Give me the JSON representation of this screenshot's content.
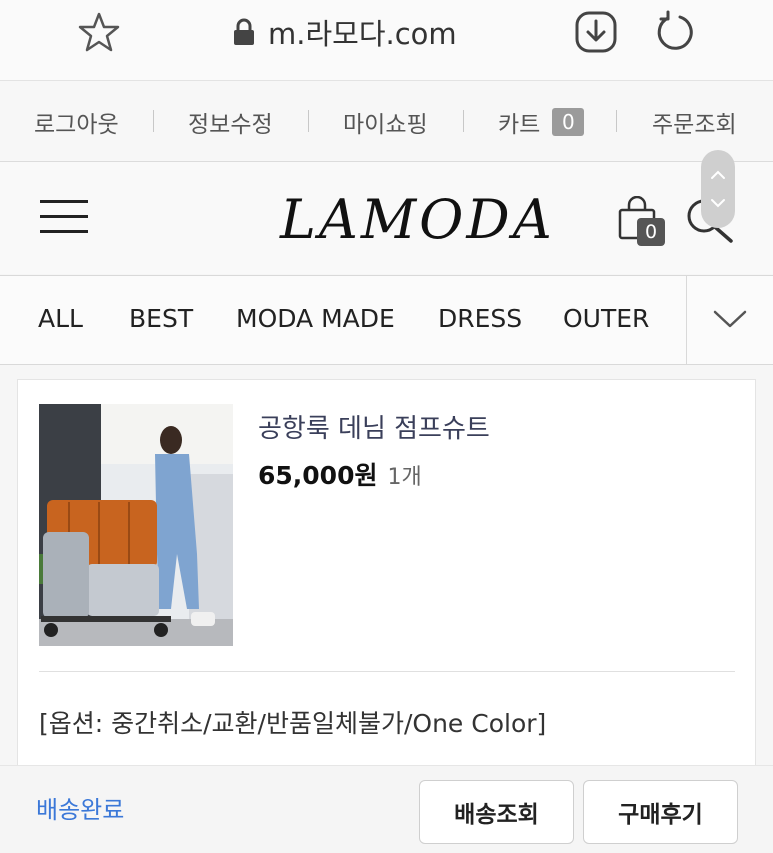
{
  "browser": {
    "url": "m.라모다.com",
    "icons": [
      "star-icon",
      "lock-icon",
      "download-icon",
      "reload-icon"
    ]
  },
  "top_links": {
    "logout": "로그아웃",
    "edit_info": "정보수정",
    "my_shopping": "마이쇼핑",
    "cart": "카트",
    "cart_count": "0",
    "order_lookup": "주문조회"
  },
  "header": {
    "logo": "LAMODA",
    "bag_count": "0"
  },
  "categories": [
    "ALL",
    "BEST",
    "MODA MADE",
    "DRESS",
    "OUTER"
  ],
  "order": {
    "product_name": "공항룩 데님 점프슈트",
    "price": "65,000원",
    "quantity": "1개",
    "option": "[옵션: 중간취소/교환/반품일체불가/One Color]"
  },
  "footer": {
    "status": "배송완료",
    "track_button": "배송조회",
    "review_button": "구매후기"
  },
  "colors": {
    "accent_blue": "#3b78d8",
    "product_name": "#3a3f5a",
    "badge_gray": "#9b9b9b"
  }
}
